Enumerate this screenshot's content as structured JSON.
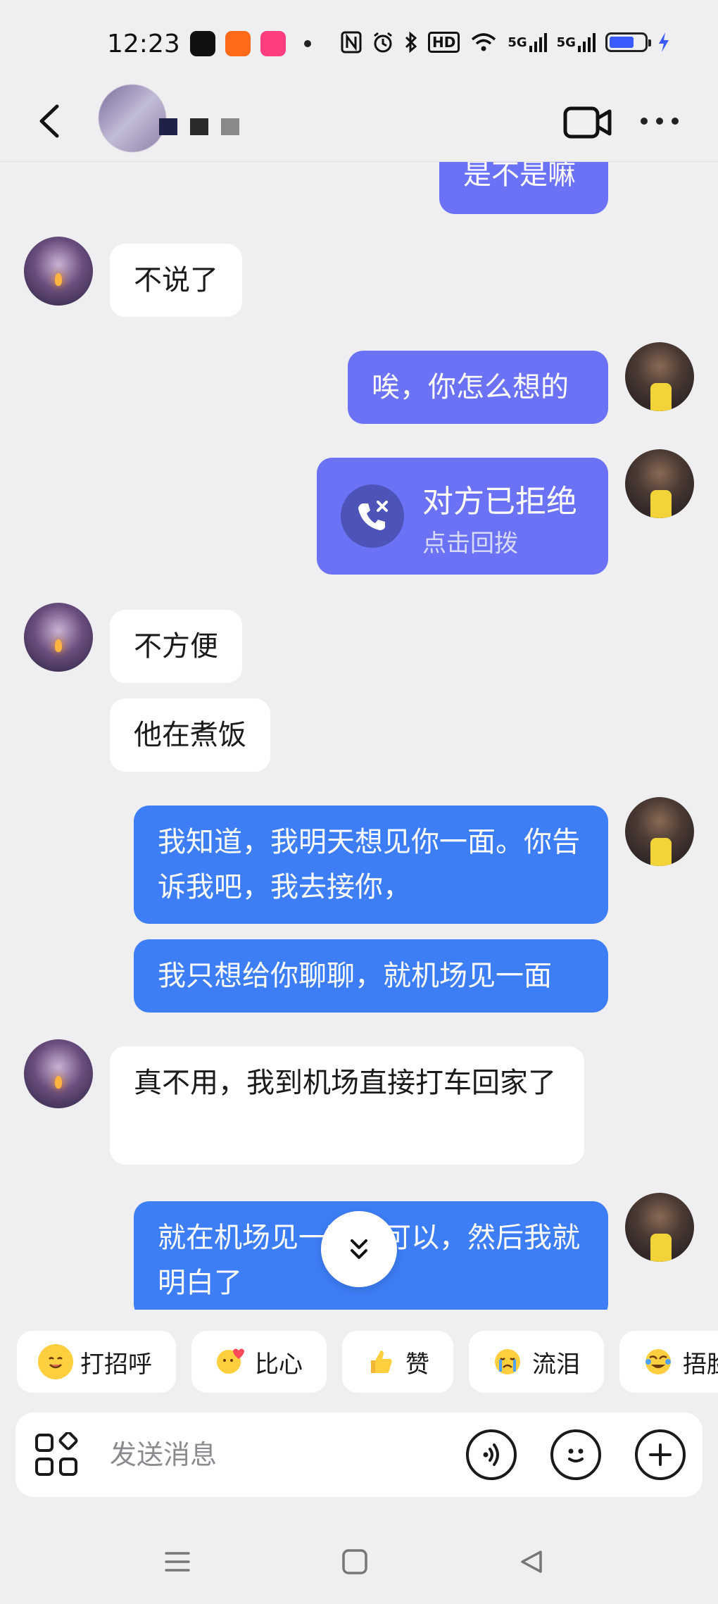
{
  "status_bar": {
    "time": "12:23",
    "network_1": "5G",
    "network_2": "5G",
    "hd_label": "HD"
  },
  "header": {
    "back": "back",
    "video_call": "video",
    "more": "more"
  },
  "messages": [
    {
      "id": "m0",
      "side": "out",
      "text": "是不是嘛"
    },
    {
      "id": "m1",
      "side": "in",
      "text": "不说了"
    },
    {
      "id": "m2",
      "side": "out",
      "text": "唉，你怎么想的"
    },
    {
      "id": "m4",
      "side": "in",
      "text": "不方便"
    },
    {
      "id": "m5",
      "side": "in",
      "text": "他在煮饭"
    },
    {
      "id": "m6",
      "side": "out",
      "text": "我知道，我明天想见你一面。你告诉我吧，我去接你，"
    },
    {
      "id": "m7",
      "side": "out",
      "text": "我只想给你聊聊，就机场见一面"
    },
    {
      "id": "m8",
      "side": "in",
      "text": "真不用，我到机场直接打车回家了"
    },
    {
      "id": "m9",
      "side": "out",
      "text": "就在机场见一面就可以，然后我就明白了"
    }
  ],
  "call_card": {
    "title": "对方已拒绝",
    "subtitle": "点击回拨"
  },
  "quick_replies": [
    {
      "label": "打招呼",
      "icon": "smile-wave-emoji"
    },
    {
      "label": "比心",
      "icon": "finger-heart-emoji"
    },
    {
      "label": "赞",
      "icon": "thumbs-up-emoji"
    },
    {
      "label": "流泪",
      "icon": "crying-emoji"
    },
    {
      "label": "捂脸",
      "icon": "facepalm-emoji"
    }
  ],
  "input": {
    "placeholder": "发送消息"
  },
  "colors": {
    "background": "#efeff1",
    "bubble_out_purple": "#6b72f5",
    "bubble_out_blue": "#3d7ef7",
    "bubble_in": "#ffffff"
  }
}
